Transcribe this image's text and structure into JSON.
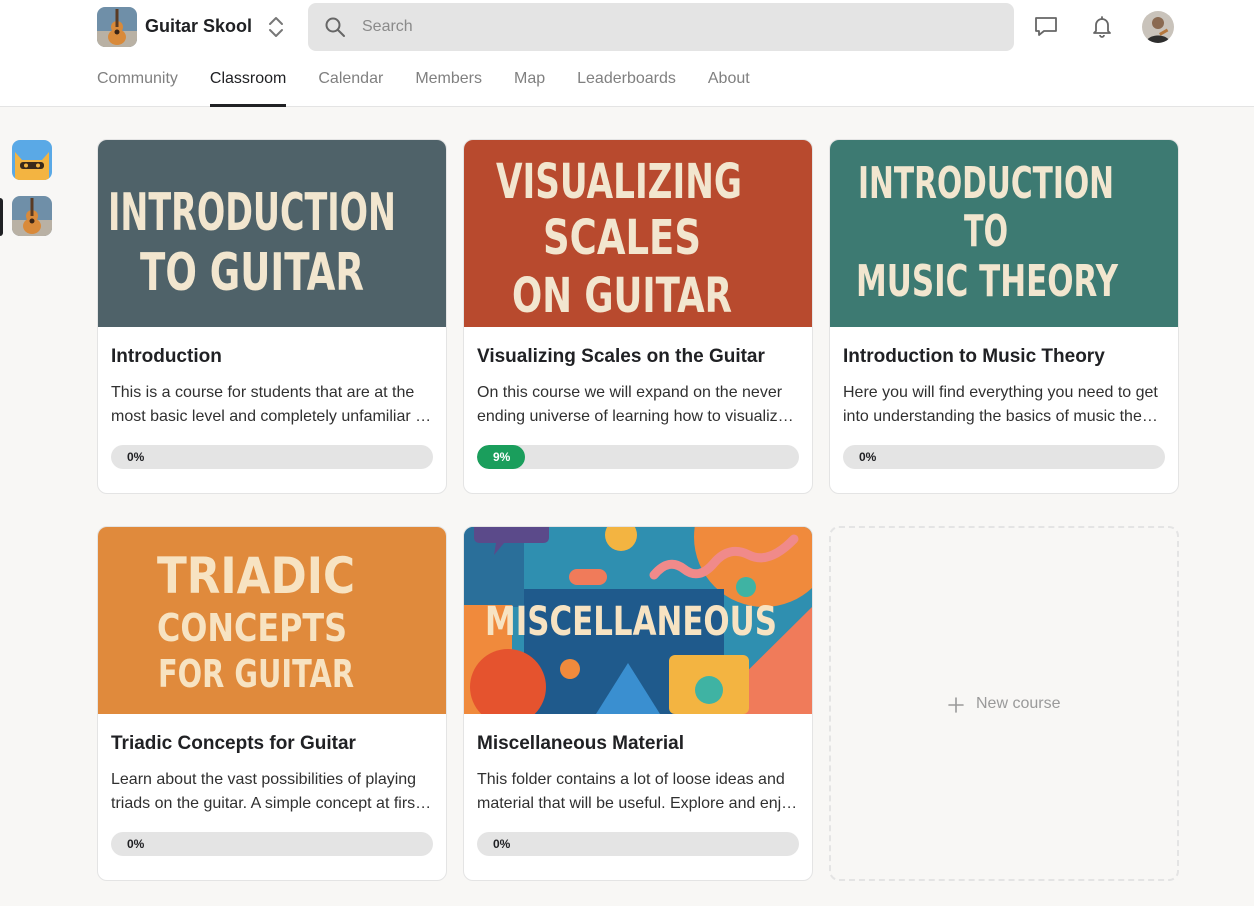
{
  "app": {
    "name": "Guitar Skool"
  },
  "search": {
    "placeholder": "Search"
  },
  "nav": {
    "tabs": [
      {
        "label": "Community"
      },
      {
        "label": "Classroom",
        "active": true
      },
      {
        "label": "Calendar"
      },
      {
        "label": "Members"
      },
      {
        "label": "Map"
      },
      {
        "label": "Leaderboards"
      },
      {
        "label": "About"
      }
    ]
  },
  "colors": {
    "progress_active": "#1a9e5c",
    "progress_track": "#e4e4e4"
  },
  "courses": [
    {
      "cover_lines": [
        "INTRODUCTION",
        "TO GUITAR"
      ],
      "cover_color": "#4f6269",
      "title": "Introduction",
      "description_lines": [
        "This is a course for students that are at the",
        "most basic level and completely unfamiliar with the guitar."
      ],
      "progress": 0,
      "progress_label": "0%"
    },
    {
      "cover_lines": [
        "VISUALIZING",
        "SCALES",
        "ON GUITAR"
      ],
      "cover_color": "#b84a2e",
      "title": "Visualizing Scales on the Guitar",
      "description_lines": [
        "On this course we will expand on the never",
        "ending universe of learning how to visualize scales."
      ],
      "progress": 9,
      "progress_label": "9%"
    },
    {
      "cover_lines": [
        "INTRODUCTION",
        "TO",
        "MUSIC THEORY"
      ],
      "cover_color": "#3d7a72",
      "title": "Introduction to Music Theory",
      "description_lines": [
        "Here you will find everything you need to get",
        "into understanding the basics of music theory."
      ],
      "progress": 0,
      "progress_label": "0%"
    },
    {
      "cover_lines": [
        "TRIADIC",
        "CONCEPTS",
        "FOR GUITAR"
      ],
      "cover_color": "#e08a3c",
      "title": "Triadic Concepts for Guitar",
      "description_lines": [
        "Learn about the vast possibilities of playing",
        "triads on the guitar. A simple concept at first glance."
      ],
      "progress": 0,
      "progress_label": "0%"
    },
    {
      "cover_lines": [
        "MISCELLANEOUS"
      ],
      "cover_color": "#2f8fb0",
      "title": "Miscellaneous Material",
      "description_lines": [
        "This folder contains a lot of loose ideas and",
        "material that will be useful. Explore and enjoy."
      ],
      "progress": 0,
      "progress_label": "0%"
    }
  ],
  "new_course": {
    "label": "New course"
  }
}
